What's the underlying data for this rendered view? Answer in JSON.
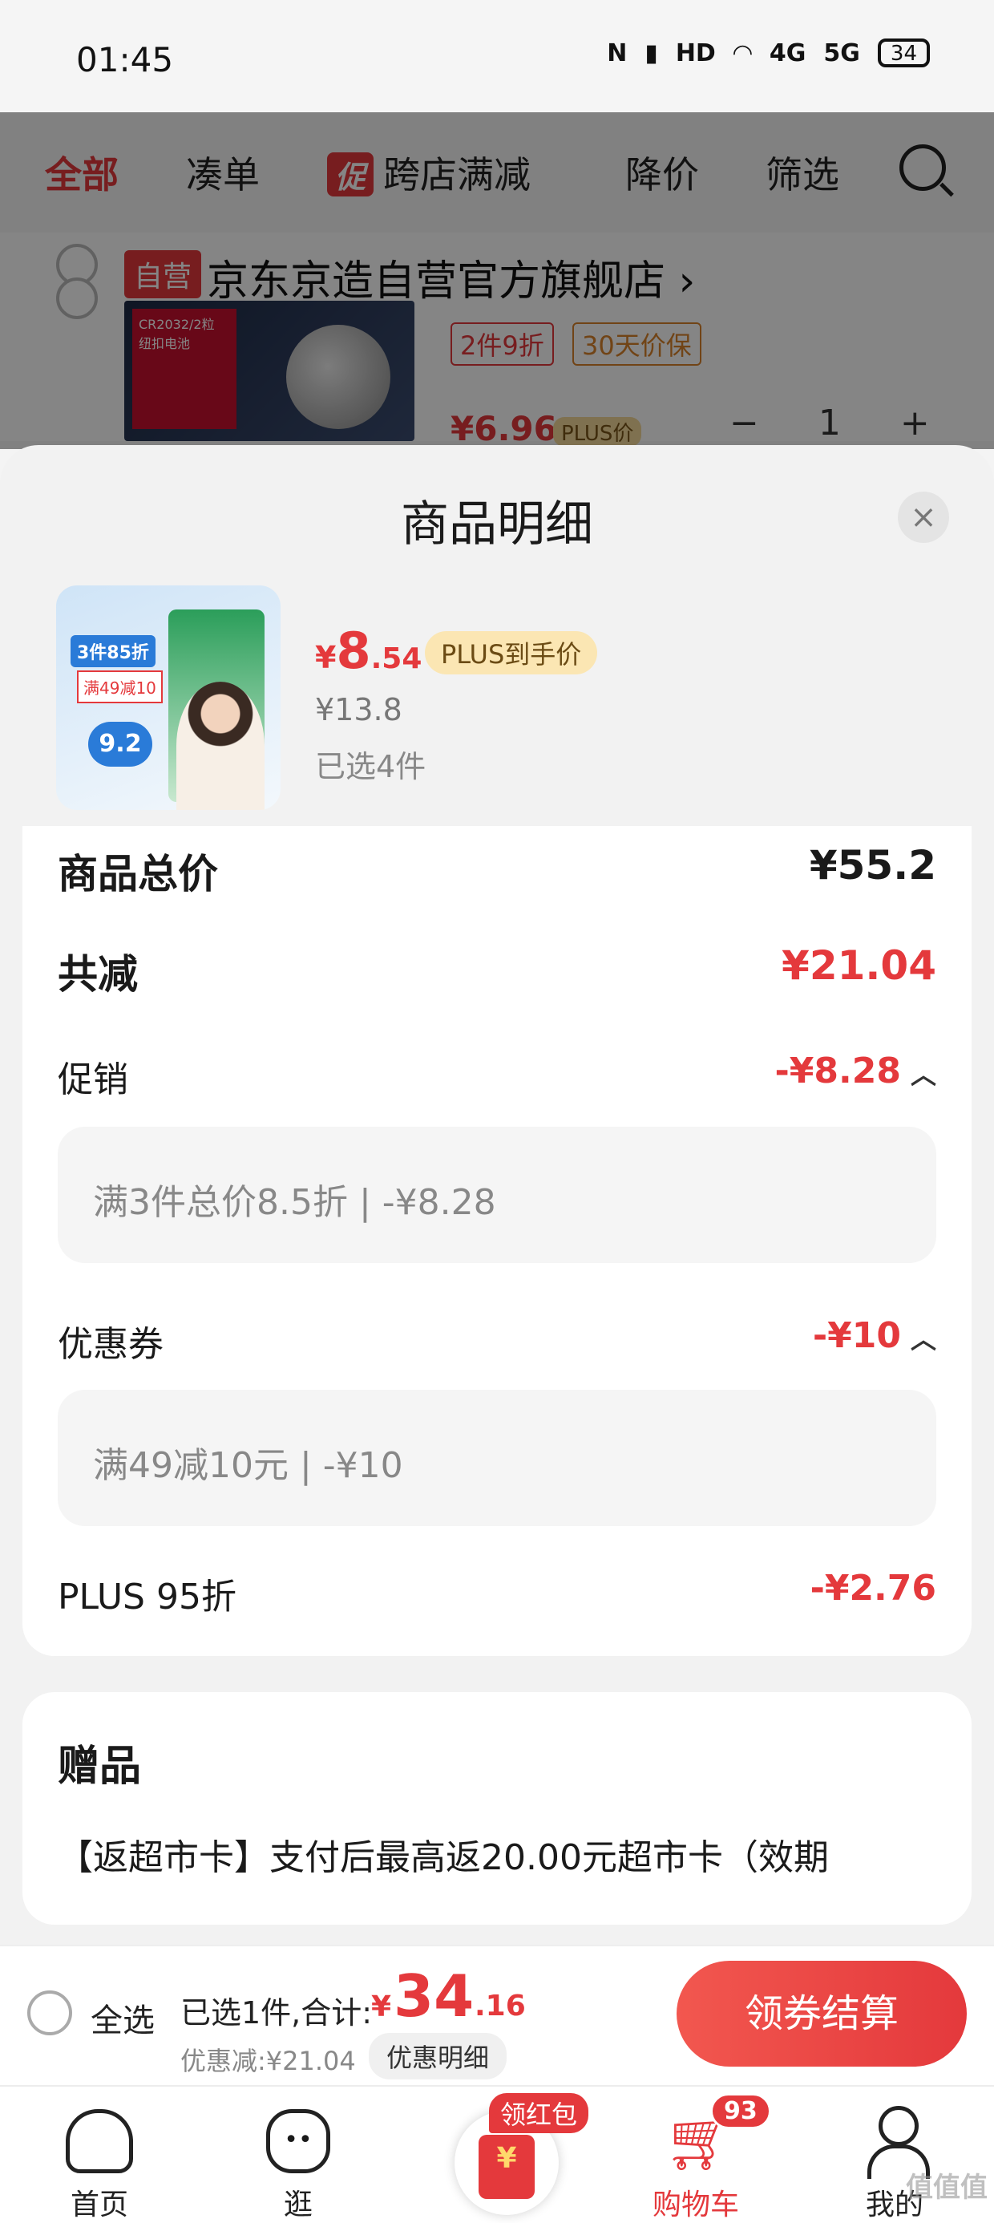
{
  "status_bar": {
    "time": "01:45",
    "icons": [
      "nfc-icon",
      "vibrate-icon",
      "hd-icon",
      "wifi-icon",
      "signal-4g-icon",
      "signal-5g-icon"
    ],
    "hd": "HD",
    "net1": "4G",
    "net2": "5G",
    "battery": "34"
  },
  "cart_page": {
    "filters": [
      "全部",
      "凑单",
      "跨店满减",
      "降价",
      "筛选"
    ],
    "promo_tag": "促",
    "store_tag": "自营",
    "store_name": "京东京造自营官方旗舰店 ›",
    "battery_label": "CR2032/2粒 纽扣电池",
    "chips": [
      "2件9折",
      "30天价保"
    ],
    "price": "¥6.96",
    "plus_label": "PLUS价",
    "qty": "1"
  },
  "sheet": {
    "title": "商品明细",
    "close": "×",
    "product": {
      "img_badge": "3件85折",
      "img_badge2": "满49减10",
      "img_badge3": "9.2",
      "price_cur": "¥",
      "price_int": "8",
      "price_dec": ".54",
      "plus_badge": "PLUS到手价",
      "orig_price": "¥13.8",
      "selected": "已选4件"
    },
    "total_label": "商品总价",
    "total_value": "¥55.2",
    "reduce_label": "共减",
    "reduce_value": "¥21.04",
    "promo_label": "促销",
    "promo_value": "-¥8.28",
    "promo_detail": "满3件总价8.5折 | -¥8.28",
    "coupon_label": "优惠券",
    "coupon_value": "-¥10",
    "coupon_detail": "满49减10元 | -¥10",
    "plus_label": "PLUS 95折",
    "plus_value": "-¥2.76",
    "gift_title": "赠品",
    "gift_text": "【返超市卡】支付后最高返20.00元超市卡（效期"
  },
  "checkout": {
    "select_all": "全选",
    "total_label": "已选1件,合计:",
    "total_cur": "¥",
    "total_int": "34",
    "total_dec": ".16",
    "discount": "优惠减:¥21.04",
    "detail_btn": "优惠明细",
    "checkout_btn": "领券结算"
  },
  "nav": {
    "home": "首页",
    "browse": "逛",
    "redpack_tag": "领红包",
    "redpack_symbol": "¥",
    "cart": "购物车",
    "cart_badge": "93",
    "mine": "我的"
  },
  "watermark": "值值值",
  "colors": {
    "accent": "#e4393c",
    "plus_gold": "#fbe6b3",
    "background": "#f2f2f2"
  }
}
